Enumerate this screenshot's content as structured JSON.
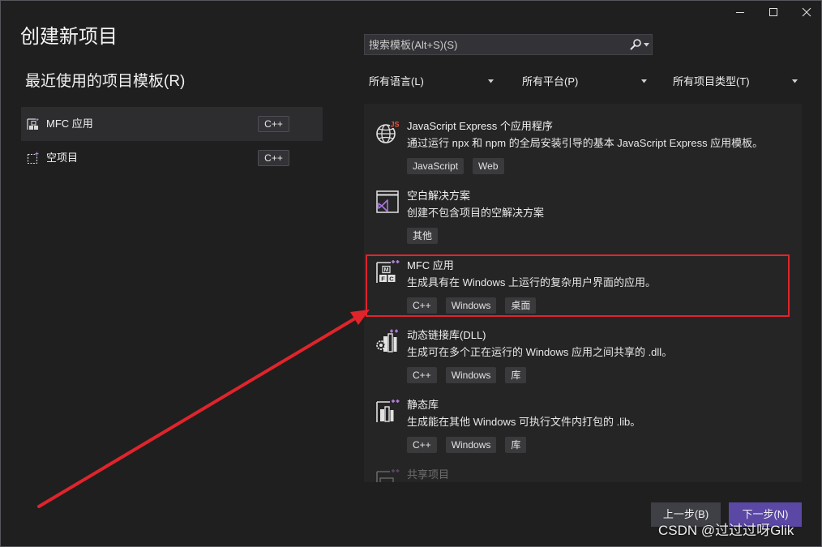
{
  "window": {
    "title": "创建新项目"
  },
  "recent": {
    "heading": "最近使用的项目模板(R)",
    "items": [
      {
        "label": "MFC 应用",
        "lang": "C++",
        "icon": "mfc-app-icon",
        "selected": true
      },
      {
        "label": "空项目",
        "lang": "C++",
        "icon": "empty-project-icon",
        "selected": false
      }
    ]
  },
  "search": {
    "placeholder": "搜索模板(Alt+S)(S)",
    "value": ""
  },
  "filters": {
    "language": "所有语言(L)",
    "platform": "所有平台(P)",
    "project_type": "所有项目类型(T)"
  },
  "templates": [
    {
      "title": "JavaScript Express 个应用程序",
      "description": "通过运行 npx 和 npm 的全局安装引导的基本 JavaScript Express 应用模板。",
      "tags": [
        "JavaScript",
        "Web"
      ],
      "icon": "globe-js-icon",
      "icon_text": "JS"
    },
    {
      "title": "空白解决方案",
      "description": "创建不包含项目的空解决方案",
      "tags": [
        "其他"
      ],
      "icon": "blank-solution-icon"
    },
    {
      "title": "MFC 应用",
      "description": "生成具有在 Windows 上运行的复杂用户界面的应用。",
      "tags": [
        "C++",
        "Windows",
        "桌面"
      ],
      "icon": "mfc-app-icon",
      "icon_letters": [
        "M",
        "F",
        "C"
      ],
      "highlighted": true
    },
    {
      "title": "动态链接库(DLL)",
      "description": "生成可在多个正在运行的 Windows 应用之间共享的 .dll。",
      "tags": [
        "C++",
        "Windows",
        "库"
      ],
      "icon": "dll-icon"
    },
    {
      "title": "静态库",
      "description": "生成能在其他 Windows 可执行文件内打包的 .lib。",
      "tags": [
        "C++",
        "Windows",
        "库"
      ],
      "icon": "static-library-icon"
    },
    {
      "title": "共享项目",
      "icon": "shared-project-icon"
    }
  ],
  "buttons": {
    "back": "上一步(B)",
    "next": "下一步(N)"
  },
  "watermark": "CSDN @过过过呀Glik",
  "colors": {
    "background": "#1f1f1f",
    "list_background": "#252526",
    "primary_button": "#5b48a5",
    "annotation": "#e0242b",
    "js_badge": "#e8543a",
    "cpp_plus": "#b77fe0"
  }
}
